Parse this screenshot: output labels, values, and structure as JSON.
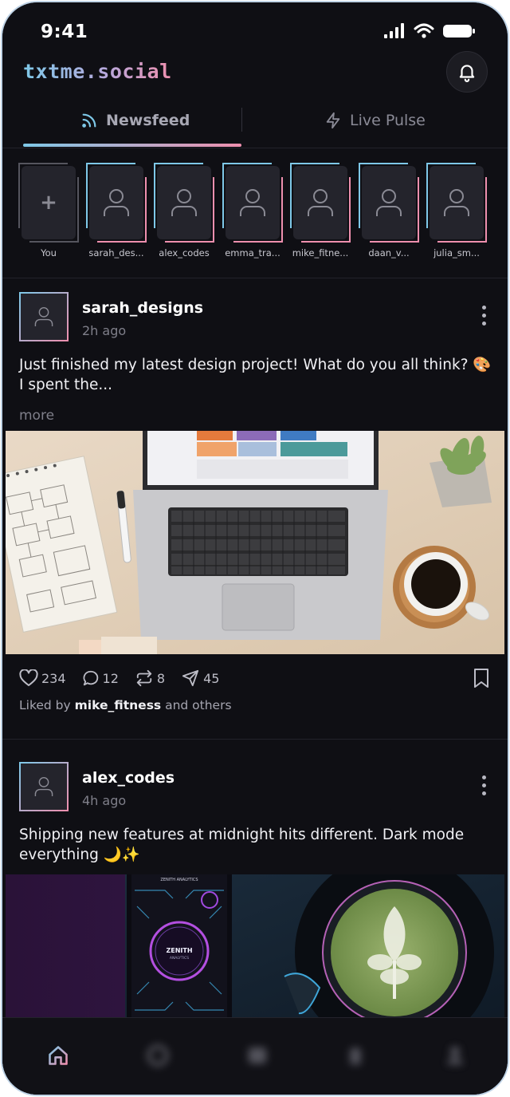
{
  "status": {
    "time": "9:41"
  },
  "header": {
    "brand": "txtme.social"
  },
  "tabs": [
    {
      "label": "Newsfeed",
      "icon": "rss-icon",
      "active": true
    },
    {
      "label": "Live Pulse",
      "icon": "lightning-icon",
      "active": false
    }
  ],
  "stories": [
    {
      "label": "You",
      "own": true
    },
    {
      "label": "sarah_des..."
    },
    {
      "label": "alex_codes"
    },
    {
      "label": "emma_tra..."
    },
    {
      "label": "mike_fitne..."
    },
    {
      "label": "daan_v..."
    },
    {
      "label": "julia_sm..."
    }
  ],
  "posts": [
    {
      "username": "sarah_designs",
      "time": "2h ago",
      "text": "Just finished my latest design project! What do you all think? 🎨 I spent the...",
      "more": "more",
      "likes": "234",
      "comments": "12",
      "reposts": "8",
      "shares": "45",
      "liked_prefix": "Liked by",
      "liked_user": "mike_fitness",
      "liked_suffix": "and others"
    },
    {
      "username": "alex_codes",
      "time": "4h ago",
      "text": "Shipping new features at midnight hits different. Dark mode everything 🌙✨",
      "phone_brand": "ZENITH",
      "phone_sub": "ANALYTICS",
      "phone_header": "ZENITH ANALYTICS"
    }
  ],
  "colors": {
    "accent_cyan": "#7ec8e8",
    "accent_pink": "#ee8fae",
    "background": "#0f0f14"
  },
  "bottom_nav": [
    "home-icon",
    "explore-icon",
    "messages-icon",
    "search-icon",
    "profile-icon"
  ]
}
